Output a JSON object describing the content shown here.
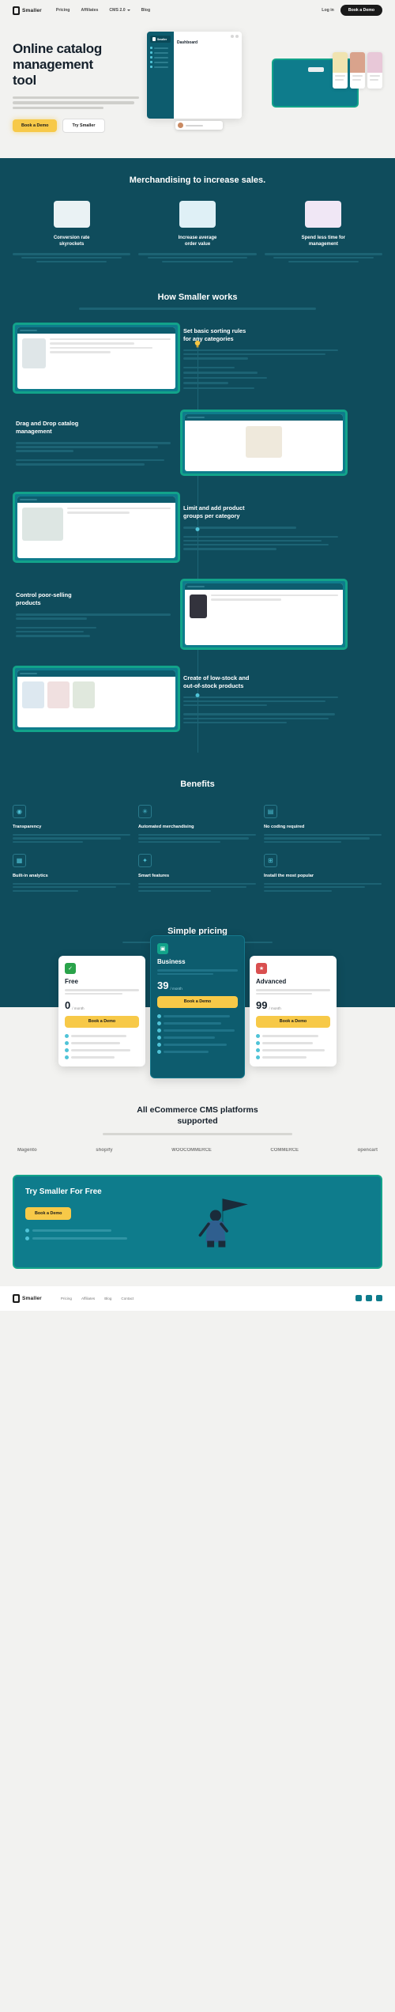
{
  "nav": {
    "brand": "Smaller",
    "links": [
      {
        "label": "Pricing",
        "has_caret": false
      },
      {
        "label": "Affiliates",
        "has_caret": false
      },
      {
        "label": "CMS 2.0",
        "has_caret": true
      },
      {
        "label": "Blog",
        "has_caret": false
      }
    ],
    "login_label": "Log in",
    "cta_label": "Book a Demo"
  },
  "hero": {
    "title_line1": "Online catalog",
    "title_line2": "management",
    "title_highlight": "tool",
    "primary_cta": "Book a Demo",
    "secondary_cta": "Try Smaller",
    "mock": {
      "brand": "Smaller",
      "page_title": "Dashboard"
    }
  },
  "merchandising": {
    "heading": "Merchandising to increase sales.",
    "features": [
      {
        "title_line1": "Conversion rate",
        "title_line2": "skyrockets",
        "icon": "conversion-chart-icon"
      },
      {
        "title_line1": "Increase average",
        "title_line2": "order value",
        "icon": "order-value-icon"
      },
      {
        "title_line1": "Spend less time for",
        "title_line2": "management",
        "icon": "time-saving-icon"
      }
    ]
  },
  "how_it_works": {
    "heading": "How Smaller works",
    "steps": [
      {
        "title_line1": "Set basic sorting rules",
        "title_line2": "for any categories",
        "media_side": "left",
        "marker": "bulb"
      },
      {
        "title_line1": "Drag and Drop catalog",
        "title_line2": "management",
        "media_side": "right",
        "marker": "dot"
      },
      {
        "title_line1": "Limit and add product",
        "title_line2": "groups per category",
        "media_side": "left",
        "marker": "dot"
      },
      {
        "title_line1": "Control poor-selling",
        "title_line2": "products",
        "media_side": "right",
        "marker": "dot"
      },
      {
        "title_line1": "Create of low-stock and",
        "title_line2": "out-of-stock products",
        "media_side": "left",
        "marker": "dot"
      }
    ]
  },
  "benefits": {
    "heading": "Benefits",
    "items": [
      {
        "title": "Transparency",
        "icon": "eye-icon"
      },
      {
        "title": "Automated merchandising",
        "icon": "gear-icon"
      },
      {
        "title": "No coding required",
        "icon": "code-icon"
      },
      {
        "title": "Built-in analytics",
        "icon": "chart-icon"
      },
      {
        "title": "Smart features",
        "icon": "sparkle-icon"
      },
      {
        "title": "Install the most popular",
        "icon": "plug-icon"
      }
    ]
  },
  "pricing": {
    "heading": "Simple pricing",
    "plans": [
      {
        "name": "Free",
        "icon": "free-plan-icon",
        "icon_color": "#2aa34a",
        "price": "0",
        "price_suffix": "/ month",
        "cta_label": "Book a Demo",
        "highlight": false,
        "features_count": 4
      },
      {
        "name": "Business",
        "icon": "business-plan-icon",
        "icon_color": "#ffffff",
        "price": "39",
        "price_suffix": "/ month",
        "cta_label": "Book a Demo",
        "highlight": true,
        "features_count": 6
      },
      {
        "name": "Advanced",
        "icon": "advanced-plan-icon",
        "icon_color": "#d94f4f",
        "price": "99",
        "price_suffix": "/ month",
        "cta_label": "Book a Demo",
        "highlight": false,
        "features_count": 4
      }
    ]
  },
  "cms": {
    "heading_line1": "All eCommerce CMS platforms",
    "heading_line2": "supported",
    "platforms": [
      "Magento",
      "shopify",
      "WOOCOMMERCE",
      "COMMERCE",
      "opencart"
    ]
  },
  "cta": {
    "heading": "Try Smaller For Free",
    "button_label": "Book a Demo",
    "bullets_count": 2
  },
  "footer": {
    "brand": "Smaller",
    "links": [
      "Pricing",
      "Affiliates",
      "Blog",
      "Contact"
    ],
    "social_count": 3
  },
  "colors": {
    "teal_bg": "#0f4c5c",
    "teal_accent": "#12a38a",
    "panel": "#0e7c8c",
    "yellow": "#f7c948",
    "cyan": "#4fc3d7",
    "light_bg": "#f2f2f0"
  }
}
